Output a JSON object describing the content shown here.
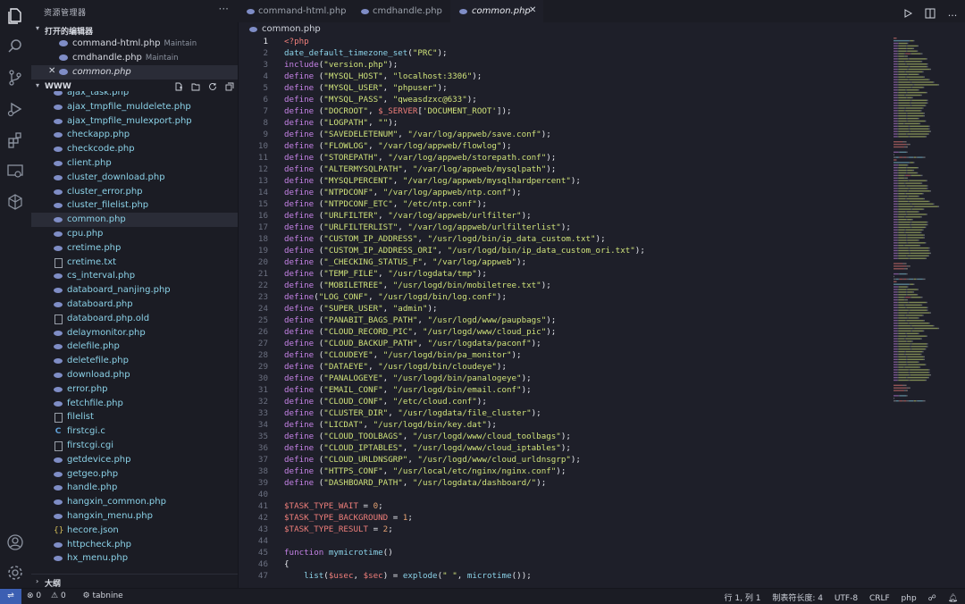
{
  "sidebar": {
    "title": "资源管理器",
    "more_icon": "ellipsis-icon",
    "open_editors_label": "打开的编辑器",
    "open_editors": [
      {
        "name": "command-html.php",
        "desc": "Maintain",
        "active": false
      },
      {
        "name": "cmdhandle.php",
        "desc": "Maintain",
        "active": false
      },
      {
        "name": "common.php",
        "desc": "",
        "active": true
      }
    ],
    "workspace_label": "WWW",
    "files": [
      {
        "name": "ajax_task.php",
        "type": "php"
      },
      {
        "name": "ajax_tmpfile_muldelete.php",
        "type": "php"
      },
      {
        "name": "ajax_tmpfile_mulexport.php",
        "type": "php"
      },
      {
        "name": "checkapp.php",
        "type": "php"
      },
      {
        "name": "checkcode.php",
        "type": "php"
      },
      {
        "name": "client.php",
        "type": "php"
      },
      {
        "name": "cluster_download.php",
        "type": "php"
      },
      {
        "name": "cluster_error.php",
        "type": "php"
      },
      {
        "name": "cluster_filelist.php",
        "type": "php"
      },
      {
        "name": "common.php",
        "type": "php",
        "active": true
      },
      {
        "name": "cpu.php",
        "type": "php"
      },
      {
        "name": "cretime.php",
        "type": "php"
      },
      {
        "name": "cretime.txt",
        "type": "txt"
      },
      {
        "name": "cs_interval.php",
        "type": "php"
      },
      {
        "name": "databoard_nanjing.php",
        "type": "php"
      },
      {
        "name": "databoard.php",
        "type": "php"
      },
      {
        "name": "databoard.php.old",
        "type": "txt"
      },
      {
        "name": "delaymonitor.php",
        "type": "php"
      },
      {
        "name": "delefile.php",
        "type": "php"
      },
      {
        "name": "deletefile.php",
        "type": "php"
      },
      {
        "name": "download.php",
        "type": "php"
      },
      {
        "name": "error.php",
        "type": "php"
      },
      {
        "name": "fetchfile.php",
        "type": "php"
      },
      {
        "name": "filelist",
        "type": "txt"
      },
      {
        "name": "firstcgi.c",
        "type": "c"
      },
      {
        "name": "firstcgi.cgi",
        "type": "txt"
      },
      {
        "name": "getdevice.php",
        "type": "php"
      },
      {
        "name": "getgeo.php",
        "type": "php"
      },
      {
        "name": "handle.php",
        "type": "php"
      },
      {
        "name": "hangxin_common.php",
        "type": "php"
      },
      {
        "name": "hangxin_menu.php",
        "type": "php"
      },
      {
        "name": "hecore.json",
        "type": "json"
      },
      {
        "name": "httpcheck.php",
        "type": "php"
      },
      {
        "name": "hx_menu.php",
        "type": "php"
      }
    ],
    "outline_label": "大纲"
  },
  "tabs": [
    {
      "name": "command-html.php",
      "active": false
    },
    {
      "name": "cmdhandle.php",
      "active": false
    },
    {
      "name": "common.php",
      "active": true
    }
  ],
  "breadcrumb": "common.php",
  "editor": {
    "current_line": 1,
    "lines": [
      [
        [
          "tag",
          "<?php"
        ]
      ],
      [
        [
          "fn",
          "date_default_timezone_set"
        ],
        [
          "plain",
          "("
        ],
        [
          "str",
          "\"PRC\""
        ],
        [
          "plain",
          ");"
        ]
      ],
      [
        [
          "kw",
          "include"
        ],
        [
          "plain",
          "("
        ],
        [
          "str",
          "\"version.php\""
        ],
        [
          "plain",
          ");"
        ]
      ],
      [
        [
          "kw",
          "define"
        ],
        [
          "plain",
          " ("
        ],
        [
          "str",
          "\"MYSQL_HOST\""
        ],
        [
          "plain",
          ", "
        ],
        [
          "str",
          "\"localhost:3306\""
        ],
        [
          "plain",
          ");"
        ]
      ],
      [
        [
          "kw",
          "define"
        ],
        [
          "plain",
          " ("
        ],
        [
          "str",
          "\"MYSQL_USER\""
        ],
        [
          "plain",
          ", "
        ],
        [
          "str",
          "\"phpuser\""
        ],
        [
          "plain",
          ");"
        ]
      ],
      [
        [
          "kw",
          "define"
        ],
        [
          "plain",
          " ("
        ],
        [
          "str",
          "\"MYSQL_PASS\""
        ],
        [
          "plain",
          ", "
        ],
        [
          "str",
          "\"qweasdzxc@633\""
        ],
        [
          "plain",
          ");"
        ]
      ],
      [
        [
          "kw",
          "define"
        ],
        [
          "plain",
          " ("
        ],
        [
          "str",
          "\"DOCROOT\""
        ],
        [
          "plain",
          ", "
        ],
        [
          "var",
          "$_SERVER"
        ],
        [
          "plain",
          "["
        ],
        [
          "str",
          "'DOCUMENT_ROOT'"
        ],
        [
          "plain",
          "]);"
        ]
      ],
      [
        [
          "kw",
          "define"
        ],
        [
          "plain",
          " ("
        ],
        [
          "str",
          "\"LOGPATH\""
        ],
        [
          "plain",
          ", "
        ],
        [
          "str",
          "\"\""
        ],
        [
          "plain",
          ");"
        ]
      ],
      [
        [
          "kw",
          "define"
        ],
        [
          "plain",
          " ("
        ],
        [
          "str",
          "\"SAVEDELETENUM\""
        ],
        [
          "plain",
          ", "
        ],
        [
          "str",
          "\"/var/log/appweb/save.conf\""
        ],
        [
          "plain",
          ");"
        ]
      ],
      [
        [
          "kw",
          "define"
        ],
        [
          "plain",
          " ("
        ],
        [
          "str",
          "\"FLOWLOG\""
        ],
        [
          "plain",
          ", "
        ],
        [
          "str",
          "\"/var/log/appweb/flowlog\""
        ],
        [
          "plain",
          ");"
        ]
      ],
      [
        [
          "kw",
          "define"
        ],
        [
          "plain",
          " ("
        ],
        [
          "str",
          "\"STOREPATH\""
        ],
        [
          "plain",
          ", "
        ],
        [
          "str",
          "\"/var/log/appweb/storepath.conf\""
        ],
        [
          "plain",
          ");"
        ]
      ],
      [
        [
          "kw",
          "define"
        ],
        [
          "plain",
          " ("
        ],
        [
          "str",
          "\"ALTERMYSQLPATH\""
        ],
        [
          "plain",
          ", "
        ],
        [
          "str",
          "\"/var/log/appweb/mysqlpath\""
        ],
        [
          "plain",
          ");"
        ]
      ],
      [
        [
          "kw",
          "define"
        ],
        [
          "plain",
          " ("
        ],
        [
          "str",
          "\"MYSQLPERCENT\""
        ],
        [
          "plain",
          ", "
        ],
        [
          "str",
          "\"/var/log/appweb/mysqlhardpercent\""
        ],
        [
          "plain",
          ");"
        ]
      ],
      [
        [
          "kw",
          "define"
        ],
        [
          "plain",
          " ("
        ],
        [
          "str",
          "\"NTPDCONF\""
        ],
        [
          "plain",
          ", "
        ],
        [
          "str",
          "\"/var/log/appweb/ntp.conf\""
        ],
        [
          "plain",
          ");"
        ]
      ],
      [
        [
          "kw",
          "define"
        ],
        [
          "plain",
          " ("
        ],
        [
          "str",
          "\"NTPDCONF_ETC\""
        ],
        [
          "plain",
          ", "
        ],
        [
          "str",
          "\"/etc/ntp.conf\""
        ],
        [
          "plain",
          ");"
        ]
      ],
      [
        [
          "kw",
          "define"
        ],
        [
          "plain",
          " ("
        ],
        [
          "str",
          "\"URLFILTER\""
        ],
        [
          "plain",
          ", "
        ],
        [
          "str",
          "\"/var/log/appweb/urlfilter\""
        ],
        [
          "plain",
          ");"
        ]
      ],
      [
        [
          "kw",
          "define"
        ],
        [
          "plain",
          " ("
        ],
        [
          "str",
          "\"URLFILTERLIST\""
        ],
        [
          "plain",
          ", "
        ],
        [
          "str",
          "\"/var/log/appweb/urlfilterlist\""
        ],
        [
          "plain",
          ");"
        ]
      ],
      [
        [
          "kw",
          "define"
        ],
        [
          "plain",
          " ("
        ],
        [
          "str",
          "\"CUSTOM_IP_ADDRESS\""
        ],
        [
          "plain",
          ", "
        ],
        [
          "str",
          "\"/usr/logd/bin/ip_data_custom.txt\""
        ],
        [
          "plain",
          ");"
        ]
      ],
      [
        [
          "kw",
          "define"
        ],
        [
          "plain",
          " ("
        ],
        [
          "str",
          "\"CUSTOM_IP_ADDRESS_ORI\""
        ],
        [
          "plain",
          ", "
        ],
        [
          "str",
          "\"/usr/logd/bin/ip_data_custom_ori.txt\""
        ],
        [
          "plain",
          ");"
        ]
      ],
      [
        [
          "kw",
          "define"
        ],
        [
          "plain",
          " ("
        ],
        [
          "str",
          "\"_CHECKING_STATUS_F\""
        ],
        [
          "plain",
          ", "
        ],
        [
          "str",
          "\"/var/log/appweb\""
        ],
        [
          "plain",
          ");"
        ]
      ],
      [
        [
          "kw",
          "define"
        ],
        [
          "plain",
          " ("
        ],
        [
          "str",
          "\"TEMP_FILE\""
        ],
        [
          "plain",
          ", "
        ],
        [
          "str",
          "\"/usr/logdata/tmp\""
        ],
        [
          "plain",
          ");"
        ]
      ],
      [
        [
          "kw",
          "define"
        ],
        [
          "plain",
          " ("
        ],
        [
          "str",
          "\"MOBILETREE\""
        ],
        [
          "plain",
          ", "
        ],
        [
          "str",
          "\"/usr/logd/bin/mobiletree.txt\""
        ],
        [
          "plain",
          ");"
        ]
      ],
      [
        [
          "kw",
          "define"
        ],
        [
          "plain",
          "("
        ],
        [
          "str",
          "\"LOG_CONF\""
        ],
        [
          "plain",
          ", "
        ],
        [
          "str",
          "\"/usr/logd/bin/log.conf\""
        ],
        [
          "plain",
          ");"
        ]
      ],
      [
        [
          "kw",
          "define"
        ],
        [
          "plain",
          " ("
        ],
        [
          "str",
          "\"SUPER_USER\""
        ],
        [
          "plain",
          ", "
        ],
        [
          "str",
          "\"admin\""
        ],
        [
          "plain",
          ");"
        ]
      ],
      [
        [
          "kw",
          "define"
        ],
        [
          "plain",
          " ("
        ],
        [
          "str",
          "\"PANABIT_BAGS_PATH\""
        ],
        [
          "plain",
          ", "
        ],
        [
          "str",
          "\"/usr/logd/www/paupbags\""
        ],
        [
          "plain",
          ");"
        ]
      ],
      [
        [
          "kw",
          "define"
        ],
        [
          "plain",
          " ("
        ],
        [
          "str",
          "\"CLOUD_RECORD_PIC\""
        ],
        [
          "plain",
          ", "
        ],
        [
          "str",
          "\"/usr/logd/www/cloud_pic\""
        ],
        [
          "plain",
          ");"
        ]
      ],
      [
        [
          "kw",
          "define"
        ],
        [
          "plain",
          " ("
        ],
        [
          "str",
          "\"CLOUD_BACKUP_PATH\""
        ],
        [
          "plain",
          ", "
        ],
        [
          "str",
          "\"/usr/logdata/paconf\""
        ],
        [
          "plain",
          ");"
        ]
      ],
      [
        [
          "kw",
          "define"
        ],
        [
          "plain",
          " ("
        ],
        [
          "str",
          "\"CLOUDEYE\""
        ],
        [
          "plain",
          ", "
        ],
        [
          "str",
          "\"/usr/logd/bin/pa_monitor\""
        ],
        [
          "plain",
          ");"
        ]
      ],
      [
        [
          "kw",
          "define"
        ],
        [
          "plain",
          " ("
        ],
        [
          "str",
          "\"DATAEYE\""
        ],
        [
          "plain",
          ", "
        ],
        [
          "str",
          "\"/usr/logd/bin/cloudeye\""
        ],
        [
          "plain",
          ");"
        ]
      ],
      [
        [
          "kw",
          "define"
        ],
        [
          "plain",
          " ("
        ],
        [
          "str",
          "\"PANALOGEYE\""
        ],
        [
          "plain",
          ", "
        ],
        [
          "str",
          "\"/usr/logd/bin/panalogeye\""
        ],
        [
          "plain",
          ");"
        ]
      ],
      [
        [
          "kw",
          "define"
        ],
        [
          "plain",
          " ("
        ],
        [
          "str",
          "\"EMAIL_CONF\""
        ],
        [
          "plain",
          ", "
        ],
        [
          "str",
          "\"/usr/logd/bin/email.conf\""
        ],
        [
          "plain",
          ");"
        ]
      ],
      [
        [
          "kw",
          "define"
        ],
        [
          "plain",
          " ("
        ],
        [
          "str",
          "\"CLOUD_CONF\""
        ],
        [
          "plain",
          ", "
        ],
        [
          "str",
          "\"/etc/cloud.conf\""
        ],
        [
          "plain",
          ");"
        ]
      ],
      [
        [
          "kw",
          "define"
        ],
        [
          "plain",
          " ("
        ],
        [
          "str",
          "\"CLUSTER_DIR\""
        ],
        [
          "plain",
          ", "
        ],
        [
          "str",
          "\"/usr/logdata/file_cluster\""
        ],
        [
          "plain",
          ");"
        ]
      ],
      [
        [
          "kw",
          "define"
        ],
        [
          "plain",
          " ("
        ],
        [
          "str",
          "\"LICDAT\""
        ],
        [
          "plain",
          ", "
        ],
        [
          "str",
          "\"/usr/logd/bin/key.dat\""
        ],
        [
          "plain",
          ");"
        ]
      ],
      [
        [
          "kw",
          "define"
        ],
        [
          "plain",
          " ("
        ],
        [
          "str",
          "\"CLOUD_TOOLBAGS\""
        ],
        [
          "plain",
          ", "
        ],
        [
          "str",
          "\"/usr/logd/www/cloud_toolbags\""
        ],
        [
          "plain",
          ");"
        ]
      ],
      [
        [
          "kw",
          "define"
        ],
        [
          "plain",
          " ("
        ],
        [
          "str",
          "\"CLOUD_IPTABLES\""
        ],
        [
          "plain",
          ", "
        ],
        [
          "str",
          "\"/usr/logd/www/cloud_iptables\""
        ],
        [
          "plain",
          ");"
        ]
      ],
      [
        [
          "kw",
          "define"
        ],
        [
          "plain",
          " ("
        ],
        [
          "str",
          "\"CLOUD_URLDNSGRP\""
        ],
        [
          "plain",
          ", "
        ],
        [
          "str",
          "\"/usr/logd/www/cloud_urldnsgrp\""
        ],
        [
          "plain",
          ");"
        ]
      ],
      [
        [
          "kw",
          "define"
        ],
        [
          "plain",
          " ("
        ],
        [
          "str",
          "\"HTTPS_CONF\""
        ],
        [
          "plain",
          ", "
        ],
        [
          "str",
          "\"/usr/local/etc/nginx/nginx.conf\""
        ],
        [
          "plain",
          ");"
        ]
      ],
      [
        [
          "kw",
          "define"
        ],
        [
          "plain",
          " ("
        ],
        [
          "str",
          "\"DASHBOARD_PATH\""
        ],
        [
          "plain",
          ", "
        ],
        [
          "str",
          "\"/usr/logdata/dashboard/\""
        ],
        [
          "plain",
          ");"
        ]
      ],
      [],
      [
        [
          "var",
          "$TASK_TYPE_WAIT"
        ],
        [
          "plain",
          " = "
        ],
        [
          "num",
          "0"
        ],
        [
          "plain",
          ";"
        ]
      ],
      [
        [
          "var",
          "$TASK_TYPE_BACKGROUND"
        ],
        [
          "plain",
          " = "
        ],
        [
          "num",
          "1"
        ],
        [
          "plain",
          ";"
        ]
      ],
      [
        [
          "var",
          "$TASK_TYPE_RESULT"
        ],
        [
          "plain",
          " = "
        ],
        [
          "num",
          "2"
        ],
        [
          "plain",
          ";"
        ]
      ],
      [],
      [
        [
          "kw",
          "function"
        ],
        [
          "plain",
          " "
        ],
        [
          "fn",
          "mymicrotime"
        ],
        [
          "plain",
          "()"
        ]
      ],
      [
        [
          "plain",
          "{"
        ]
      ],
      [
        [
          "plain",
          "    "
        ],
        [
          "fn",
          "list"
        ],
        [
          "plain",
          "("
        ],
        [
          "var",
          "$usec"
        ],
        [
          "plain",
          ", "
        ],
        [
          "var",
          "$sec"
        ],
        [
          "plain",
          ") = "
        ],
        [
          "fn",
          "explode"
        ],
        [
          "plain",
          "("
        ],
        [
          "str",
          "\" \""
        ],
        [
          "plain",
          ", "
        ],
        [
          "fn",
          "microtime"
        ],
        [
          "plain",
          "());"
        ]
      ]
    ]
  },
  "statusbar": {
    "remote_icon": "remote-icon",
    "errors": "0",
    "warnings": "0",
    "extension": "tabnine",
    "position": "行 1, 列 1",
    "tab_size": "制表符长度: 4",
    "encoding": "UTF-8",
    "eol": "CRLF",
    "language": "php"
  },
  "colors": {
    "background": "#1e1f29",
    "sidebar": "#1b1c24",
    "keyword": "#c582e6",
    "string": "#cfe27a",
    "function": "#8bd2e8",
    "variable": "#ee7e7a",
    "number": "#e6a373",
    "remote": "#3c5fb2"
  }
}
